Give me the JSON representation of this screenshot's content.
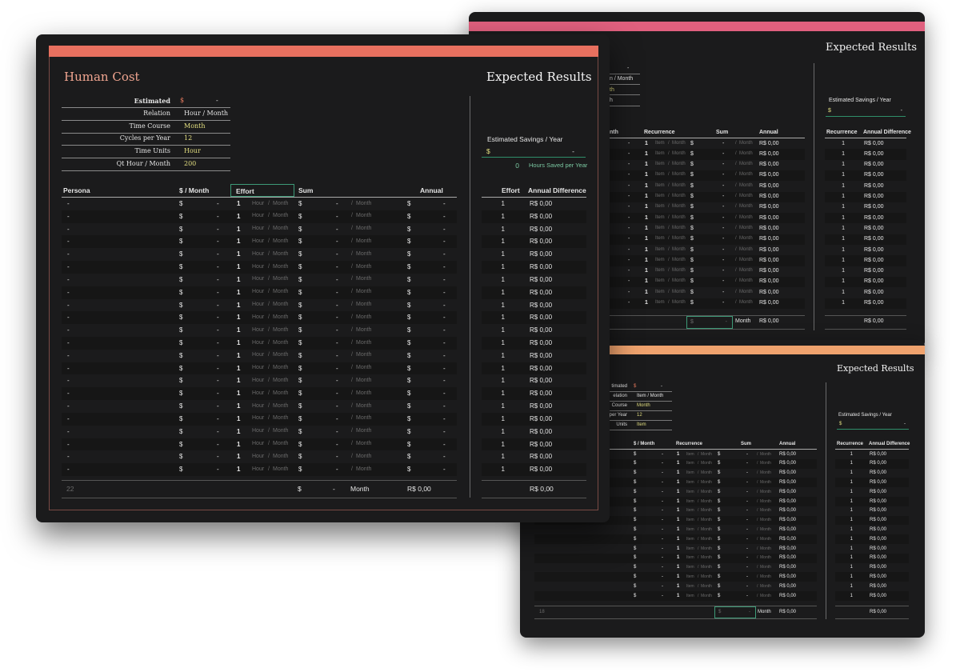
{
  "colors": {
    "main_bar": "#e8705f",
    "back1_bar": "#e0607e",
    "back2_bar": "#f0a36e",
    "card_bg": "#1b1b1c",
    "yellow_value": "#e3df80",
    "green_value": "#7ac7a1",
    "accent_box": "#3d9a77"
  },
  "main": {
    "title": "Human Cost",
    "results_title": "Expected Results",
    "params": [
      {
        "label": "Estimated",
        "value": "-",
        "currency": "$"
      },
      {
        "label": "Relation",
        "value": "Hour / Month"
      },
      {
        "label": "Time Course",
        "value": "Month"
      },
      {
        "label": "Cycles per Year",
        "value": "12"
      },
      {
        "label": "Time Units",
        "value": "Hour"
      },
      {
        "label": "Qt  Hour / Month",
        "value": "200"
      }
    ],
    "savings_label": "Estimated Savings / Year",
    "savings_currency": "$",
    "savings_value": "-",
    "hours_saved_value": "0",
    "hours_saved_label": "Hours Saved per Year",
    "columns": {
      "persona": "Persona",
      "cost": "$ / Month",
      "effort": "Effort",
      "sum": "Sum",
      "annual": "Annual"
    },
    "results_columns": {
      "effort": "Effort",
      "diff": "Annual Difference"
    },
    "row_template": {
      "persona": "-",
      "cost_currency": "$",
      "cost": "-",
      "effort": "1",
      "effort_unit1": "Hour",
      "slash": "/",
      "effort_unit2": "Month",
      "sum_currency": "$",
      "sum": "-",
      "sum_unit": "Month",
      "annual_currency": "$",
      "annual": "-",
      "result_effort": "1",
      "result_diff": "R$ 0,00"
    },
    "footer": {
      "count": "22",
      "sum_currency": "$",
      "sum": "-",
      "sum_unit": "Month",
      "annual": "R$ 0,00",
      "diff_total": "R$ 0,00"
    }
  },
  "back1": {
    "results_title": "Expected Results",
    "frag_lines": [
      "-",
      "n / Month",
      "th",
      "h"
    ],
    "savings_label": "Estimated Savings / Year",
    "savings_currency": "$",
    "savings_value": "-",
    "columns": {
      "month": "nth",
      "recurrence": "Recurrence",
      "sum": "Sum",
      "annual": "Annual"
    },
    "results_columns": {
      "recurrence": "Recurrence",
      "diff": "Annual Difference"
    },
    "row_template": {
      "cost": "-",
      "rec": "1",
      "unit1": "Item",
      "slash": "/",
      "unit2": "Month",
      "sum_currency": "$",
      "sum": "-",
      "sum_unit": "Month",
      "annual": "R$ 0,00",
      "result_rec": "1",
      "result_diff": "R$ 0,00"
    },
    "footer": {
      "sum_currency": "$",
      "sum": "-",
      "sum_unit": "Month",
      "annual": "R$ 0,00",
      "diff_total": "R$ 0,00"
    }
  },
  "back2": {
    "results_title": "Expected Results",
    "params": [
      {
        "label": "timated",
        "value": "-",
        "currency": "$"
      },
      {
        "label": "elation",
        "value": "Item / Month"
      },
      {
        "label": "Course",
        "value": "Month"
      },
      {
        "label": "per Year",
        "value": "12"
      },
      {
        "label": "Units",
        "value": "Item"
      }
    ],
    "savings_label": "Estimated Savings / Year",
    "savings_currency": "$",
    "savings_value": "-",
    "columns": {
      "cost": "$ / Month",
      "recurrence": "Recurrence",
      "sum": "Sum",
      "annual": "Annual"
    },
    "results_columns": {
      "recurrence": "Recurrence",
      "diff": "Annual Difference"
    },
    "row_template": {
      "cost_currency": "$",
      "cost": "-",
      "rec": "1",
      "unit1": "Item",
      "slash": "/",
      "unit2": "Month",
      "sum_currency": "$",
      "sum": "-",
      "sum_unit": "Month",
      "annual": "R$ 0,00",
      "result_rec": "1",
      "result_diff": "R$ 0,00"
    },
    "footer": {
      "count": "18",
      "sum_currency": "$",
      "sum": "-",
      "sum_unit": "Month",
      "annual": "R$ 0,00",
      "diff_total": "R$ 0,00"
    }
  }
}
